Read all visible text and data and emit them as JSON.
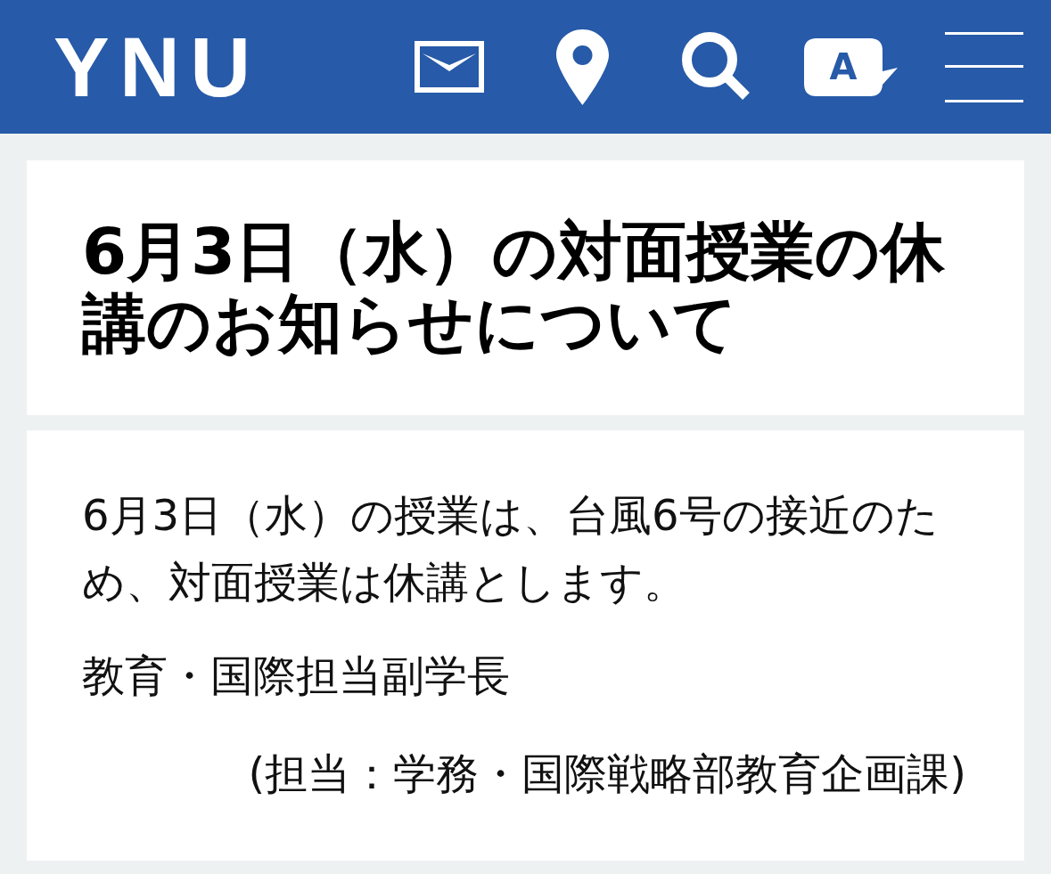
{
  "header": {
    "logo": "YNU",
    "nav": [
      {
        "kind": "mail"
      },
      {
        "kind": "location"
      },
      {
        "kind": "search"
      },
      {
        "kind": "language",
        "label": "A"
      },
      {
        "kind": "menu"
      }
    ]
  },
  "title": "6月3日（水）の対面授業の休講のお知らせについて",
  "body": {
    "paragraphs": [
      "6月3日（水）の授業は、台風6号の接近のため、対面授業は休講とします。",
      "教育・国際担当副学長"
    ],
    "contact": "(担当：学務・国際戦略部教育企画課)"
  }
}
